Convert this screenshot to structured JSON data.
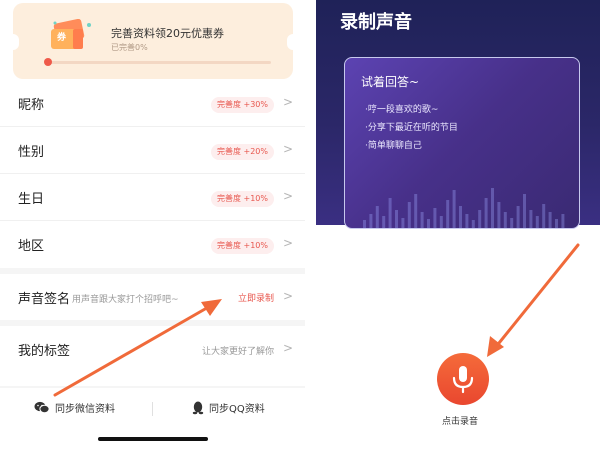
{
  "left_panel": {
    "coupon": {
      "title": "完善资料领20元优惠券",
      "progress_text": "已完善0%",
      "progress_fraction": 0,
      "ticket_glyph": "券"
    },
    "rows": [
      {
        "label": "昵称",
        "badge": "完善度 +30%"
      },
      {
        "label": "性别",
        "badge": "完善度 +20%"
      },
      {
        "label": "生日",
        "badge": "完善度 +10%"
      },
      {
        "label": "地区",
        "badge": "完善度 +10%"
      }
    ],
    "voice_signature": {
      "label": "声音签名",
      "hint": "用声音跟大家打个招呼吧~",
      "action": "立即录制"
    },
    "my_tags": {
      "label": "我的标签",
      "hint": "让大家更好了解你"
    },
    "sync": {
      "wechat": "同步微信资料",
      "qq": "同步QQ资料"
    },
    "chevron": ">"
  },
  "right_panel": {
    "title": "录制声音",
    "card": {
      "title": "试着回答~",
      "bullets": [
        "·哼一段喜欢的歌~",
        "·分享下最近在听的节目",
        "·简单聊聊自己"
      ]
    },
    "record_label": "点击录音"
  },
  "colors": {
    "accent": "#e8574e",
    "record_button": "#ef5a3a",
    "arrow": "#f06a3a",
    "dark_bg": "#2b2768"
  },
  "icons": [
    "ticket-icon",
    "chevron-right-icon",
    "wechat-icon",
    "qq-icon",
    "microphone-icon"
  ]
}
